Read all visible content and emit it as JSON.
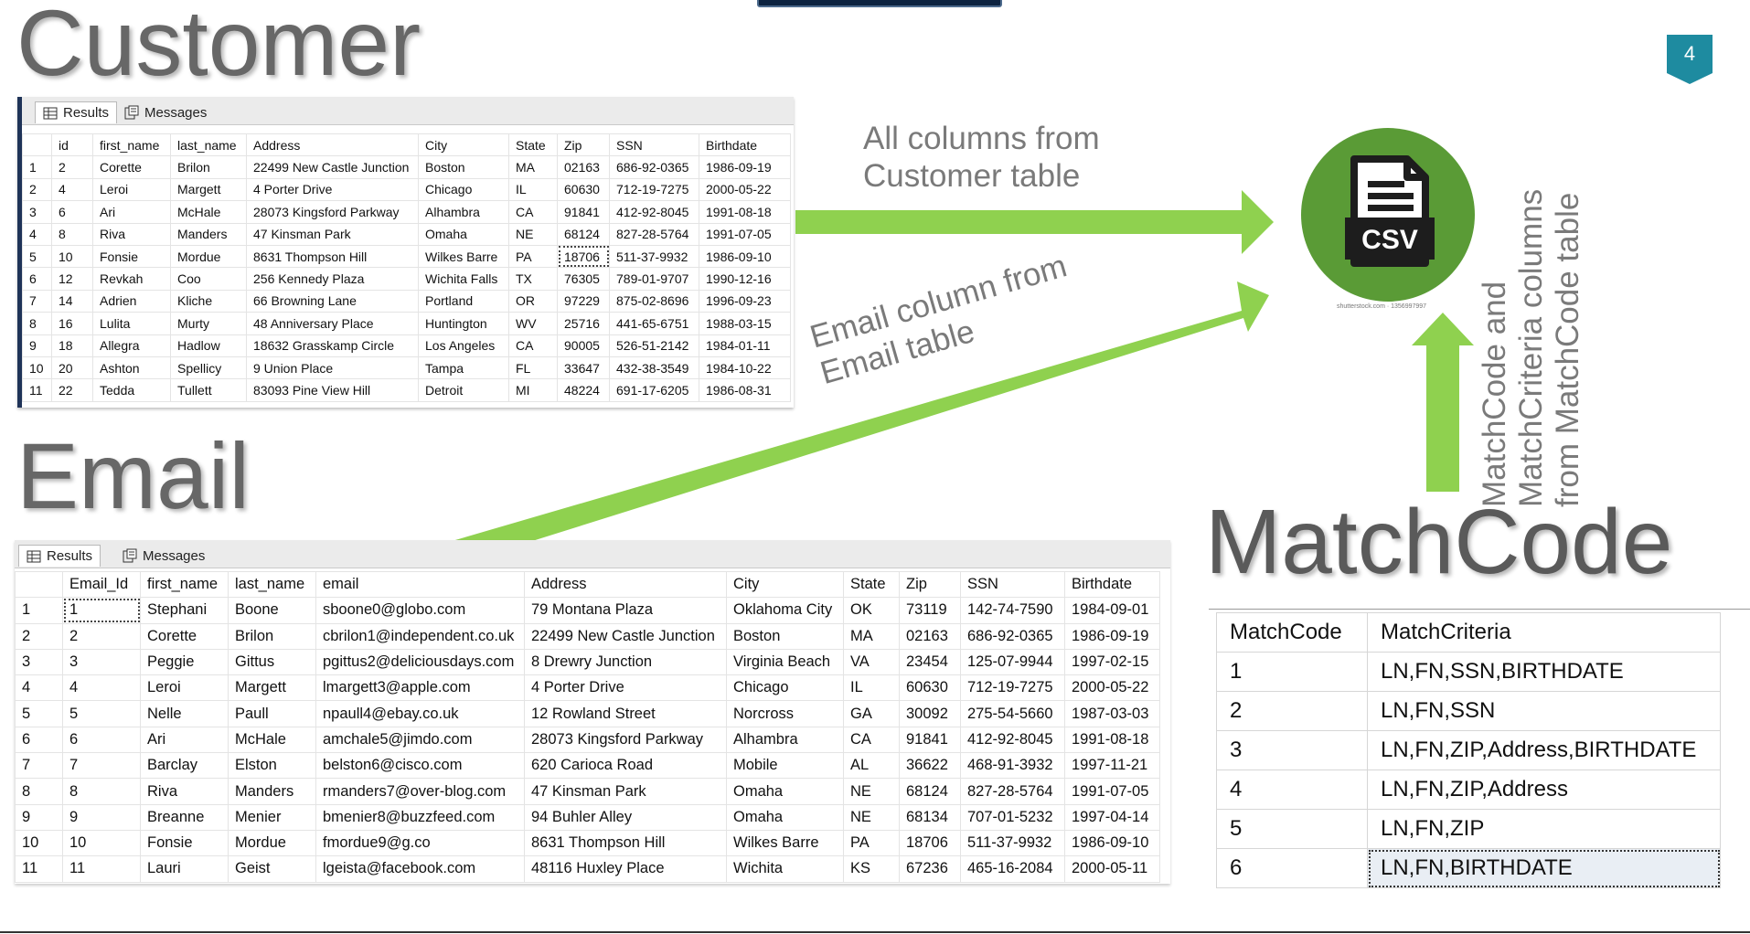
{
  "slide": {
    "titles": {
      "customer": "Customer",
      "email": "Email",
      "matchcode": "MatchCode"
    },
    "page_number": "4",
    "annotations": {
      "customer_arrow": [
        "All columns from",
        "Customer table"
      ],
      "email_arrow": [
        "Email column from",
        "Email table"
      ],
      "matchcode_arrow": [
        "MatchCode and",
        "MatchCriteria columns",
        "from MatchCode table"
      ]
    },
    "colors": {
      "arrow": "#8fd14f",
      "csv_circle": "#5a9b36",
      "badge": "#1e8ba0",
      "title": "#676767"
    }
  },
  "csv_icon": {
    "label": "CSV",
    "credit": "shutterstock.com · 1356997997",
    "icon": "csv-file-icon"
  },
  "tabs": {
    "results": "Results",
    "messages": "Messages",
    "results_icon": "grid-icon",
    "messages_icon": "messages-icon"
  },
  "customer_grid": {
    "columns": [
      "",
      "id",
      "first_name",
      "last_name",
      "Address",
      "City",
      "State",
      "Zip",
      "SSN",
      "Birthdate"
    ],
    "rows": [
      [
        "1",
        "2",
        "Corette",
        "Brilon",
        "22499 New Castle Junction",
        "Boston",
        "MA",
        "02163",
        "686-92-0365",
        "1986-09-19"
      ],
      [
        "2",
        "4",
        "Leroi",
        "Margett",
        "4 Porter Drive",
        "Chicago",
        "IL",
        "60630",
        "712-19-7275",
        "2000-05-22"
      ],
      [
        "3",
        "6",
        "Ari",
        "McHale",
        "28073 Kingsford Parkway",
        "Alhambra",
        "CA",
        "91841",
        "412-92-8045",
        "1991-08-18"
      ],
      [
        "4",
        "8",
        "Riva",
        "Manders",
        "47 Kinsman Park",
        "Omaha",
        "NE",
        "68124",
        "827-28-5764",
        "1991-07-05"
      ],
      [
        "5",
        "10",
        "Fonsie",
        "Mordue",
        "8631 Thompson Hill",
        "Wilkes Barre",
        "PA",
        "18706",
        "511-37-9932",
        "1986-09-10"
      ],
      [
        "6",
        "12",
        "Revkah",
        "Coo",
        "256 Kennedy Plaza",
        "Wichita Falls",
        "TX",
        "76305",
        "789-01-9707",
        "1990-12-16"
      ],
      [
        "7",
        "14",
        "Adrien",
        "Kliche",
        "66 Browning Lane",
        "Portland",
        "OR",
        "97229",
        "875-02-8696",
        "1996-09-23"
      ],
      [
        "8",
        "16",
        "Lulita",
        "Murty",
        "48 Anniversary Place",
        "Huntington",
        "WV",
        "25716",
        "441-65-6751",
        "1988-03-15"
      ],
      [
        "9",
        "18",
        "Allegra",
        "Hadlow",
        "18632 Grasskamp Circle",
        "Los Angeles",
        "CA",
        "90005",
        "526-51-2142",
        "1984-01-11"
      ],
      [
        "10",
        "20",
        "Ashton",
        "Spellicy",
        "9 Union Place",
        "Tampa",
        "FL",
        "33647",
        "432-38-3549",
        "1984-10-22"
      ],
      [
        "11",
        "22",
        "Tedda",
        "Tullett",
        "83093 Pine View Hill",
        "Detroit",
        "MI",
        "48224",
        "691-17-6205",
        "1986-08-31"
      ]
    ]
  },
  "email_grid": {
    "columns": [
      "",
      "Email_Id",
      "first_name",
      "last_name",
      "email",
      "Address",
      "City",
      "State",
      "Zip",
      "SSN",
      "Birthdate"
    ],
    "rows": [
      [
        "1",
        "1",
        "Stephani",
        "Boone",
        "sboone0@globo.com",
        "79 Montana Plaza",
        "Oklahoma City",
        "OK",
        "73119",
        "142-74-7590",
        "1984-09-01"
      ],
      [
        "2",
        "2",
        "Corette",
        "Brilon",
        "cbrilon1@independent.co.uk",
        "22499 New Castle Junction",
        "Boston",
        "MA",
        "02163",
        "686-92-0365",
        "1986-09-19"
      ],
      [
        "3",
        "3",
        "Peggie",
        "Gittus",
        "pgittus2@deliciousdays.com",
        "8 Drewry Junction",
        "Virginia Beach",
        "VA",
        "23454",
        "125-07-9944",
        "1997-02-15"
      ],
      [
        "4",
        "4",
        "Leroi",
        "Margett",
        "lmargett3@apple.com",
        "4 Porter Drive",
        "Chicago",
        "IL",
        "60630",
        "712-19-7275",
        "2000-05-22"
      ],
      [
        "5",
        "5",
        "Nelle",
        "Paull",
        "npaull4@ebay.co.uk",
        "12 Rowland Street",
        "Norcross",
        "GA",
        "30092",
        "275-54-5660",
        "1987-03-03"
      ],
      [
        "6",
        "6",
        "Ari",
        "McHale",
        "amchale5@jimdo.com",
        "28073 Kingsford Parkway",
        "Alhambra",
        "CA",
        "91841",
        "412-92-8045",
        "1991-08-18"
      ],
      [
        "7",
        "7",
        "Barclay",
        "Elston",
        "belston6@cisco.com",
        "620 Carioca Road",
        "Mobile",
        "AL",
        "36622",
        "468-91-3932",
        "1997-11-21"
      ],
      [
        "8",
        "8",
        "Riva",
        "Manders",
        "rmanders7@over-blog.com",
        "47 Kinsman Park",
        "Omaha",
        "NE",
        "68124",
        "827-28-5764",
        "1991-07-05"
      ],
      [
        "9",
        "9",
        "Breanne",
        "Menier",
        "bmenier8@buzzfeed.com",
        "94 Buhler Alley",
        "Omaha",
        "NE",
        "68134",
        "707-01-5232",
        "1997-04-14"
      ],
      [
        "10",
        "10",
        "Fonsie",
        "Mordue",
        "fmordue9@g.co",
        "8631 Thompson Hill",
        "Wilkes Barre",
        "PA",
        "18706",
        "511-37-9932",
        "1986-09-10"
      ],
      [
        "11",
        "11",
        "Lauri",
        "Geist",
        "lgeista@facebook.com",
        "48116 Huxley Place",
        "Wichita",
        "KS",
        "67236",
        "465-16-2084",
        "2000-05-11"
      ]
    ]
  },
  "matchcode_grid": {
    "columns": [
      "MatchCode",
      "MatchCriteria"
    ],
    "rows": [
      [
        "1",
        "LN,FN,SSN,BIRTHDATE"
      ],
      [
        "2",
        "LN,FN,SSN"
      ],
      [
        "3",
        "LN,FN,ZIP,Address,BIRTHDATE"
      ],
      [
        "4",
        "LN,FN,ZIP,Address"
      ],
      [
        "5",
        "LN,FN,ZIP"
      ],
      [
        "6",
        "LN,FN,BIRTHDATE"
      ]
    ]
  }
}
